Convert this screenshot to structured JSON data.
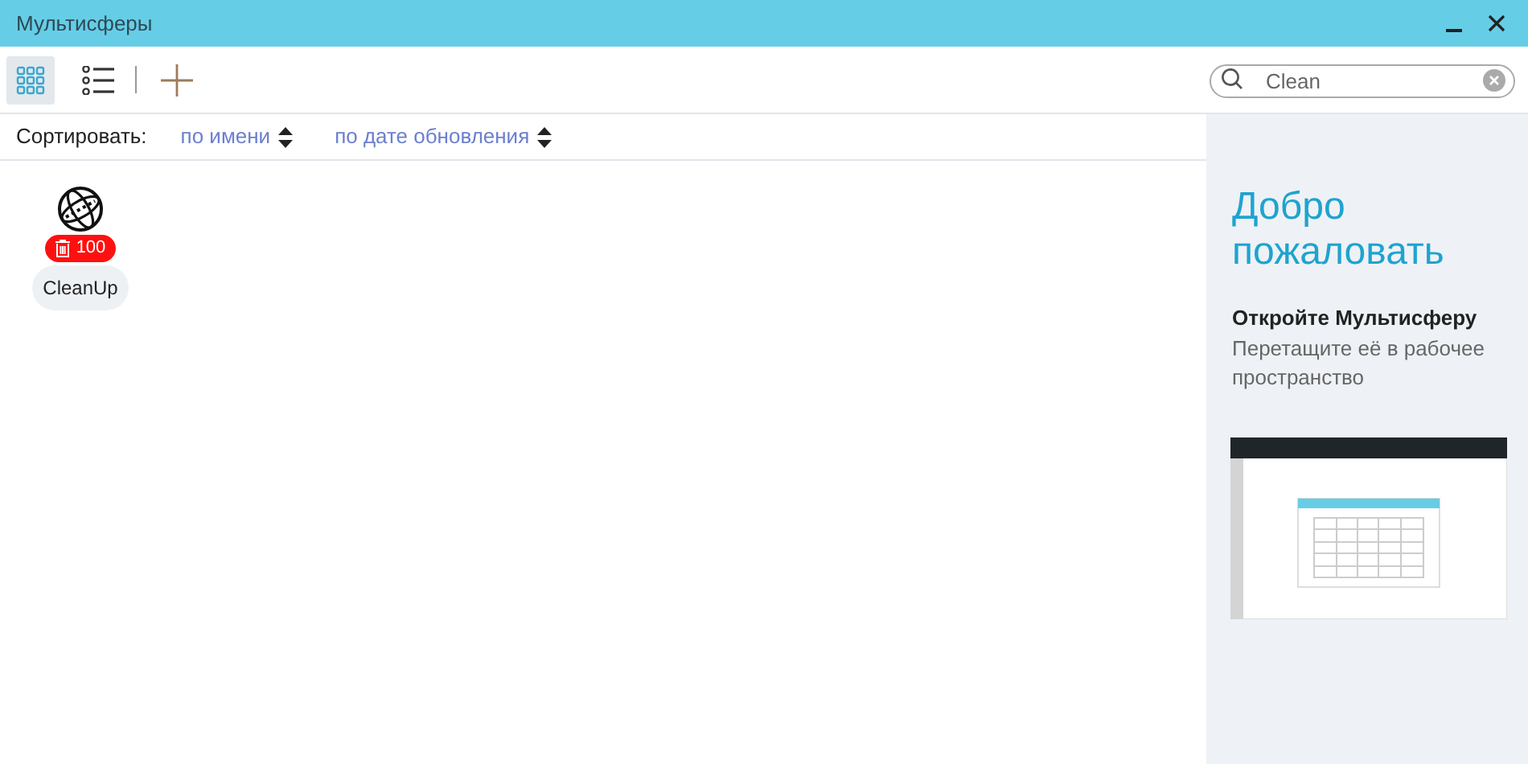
{
  "window": {
    "title": "Мультисферы"
  },
  "view_modes": [
    {
      "kind": "grid",
      "selected": true
    },
    {
      "kind": "list",
      "selected": false
    }
  ],
  "search": {
    "value": "Clean"
  },
  "sort": {
    "label": "Сортировать:",
    "options": [
      "по имени",
      "по дате обновления"
    ]
  },
  "items": [
    {
      "name": "CleanUp",
      "badge": "100"
    }
  ],
  "welcome": {
    "title": "Добро пожаловать",
    "heading": "Откройте Мультисферу",
    "text": "Перетащите её в рабочее пространство"
  }
}
